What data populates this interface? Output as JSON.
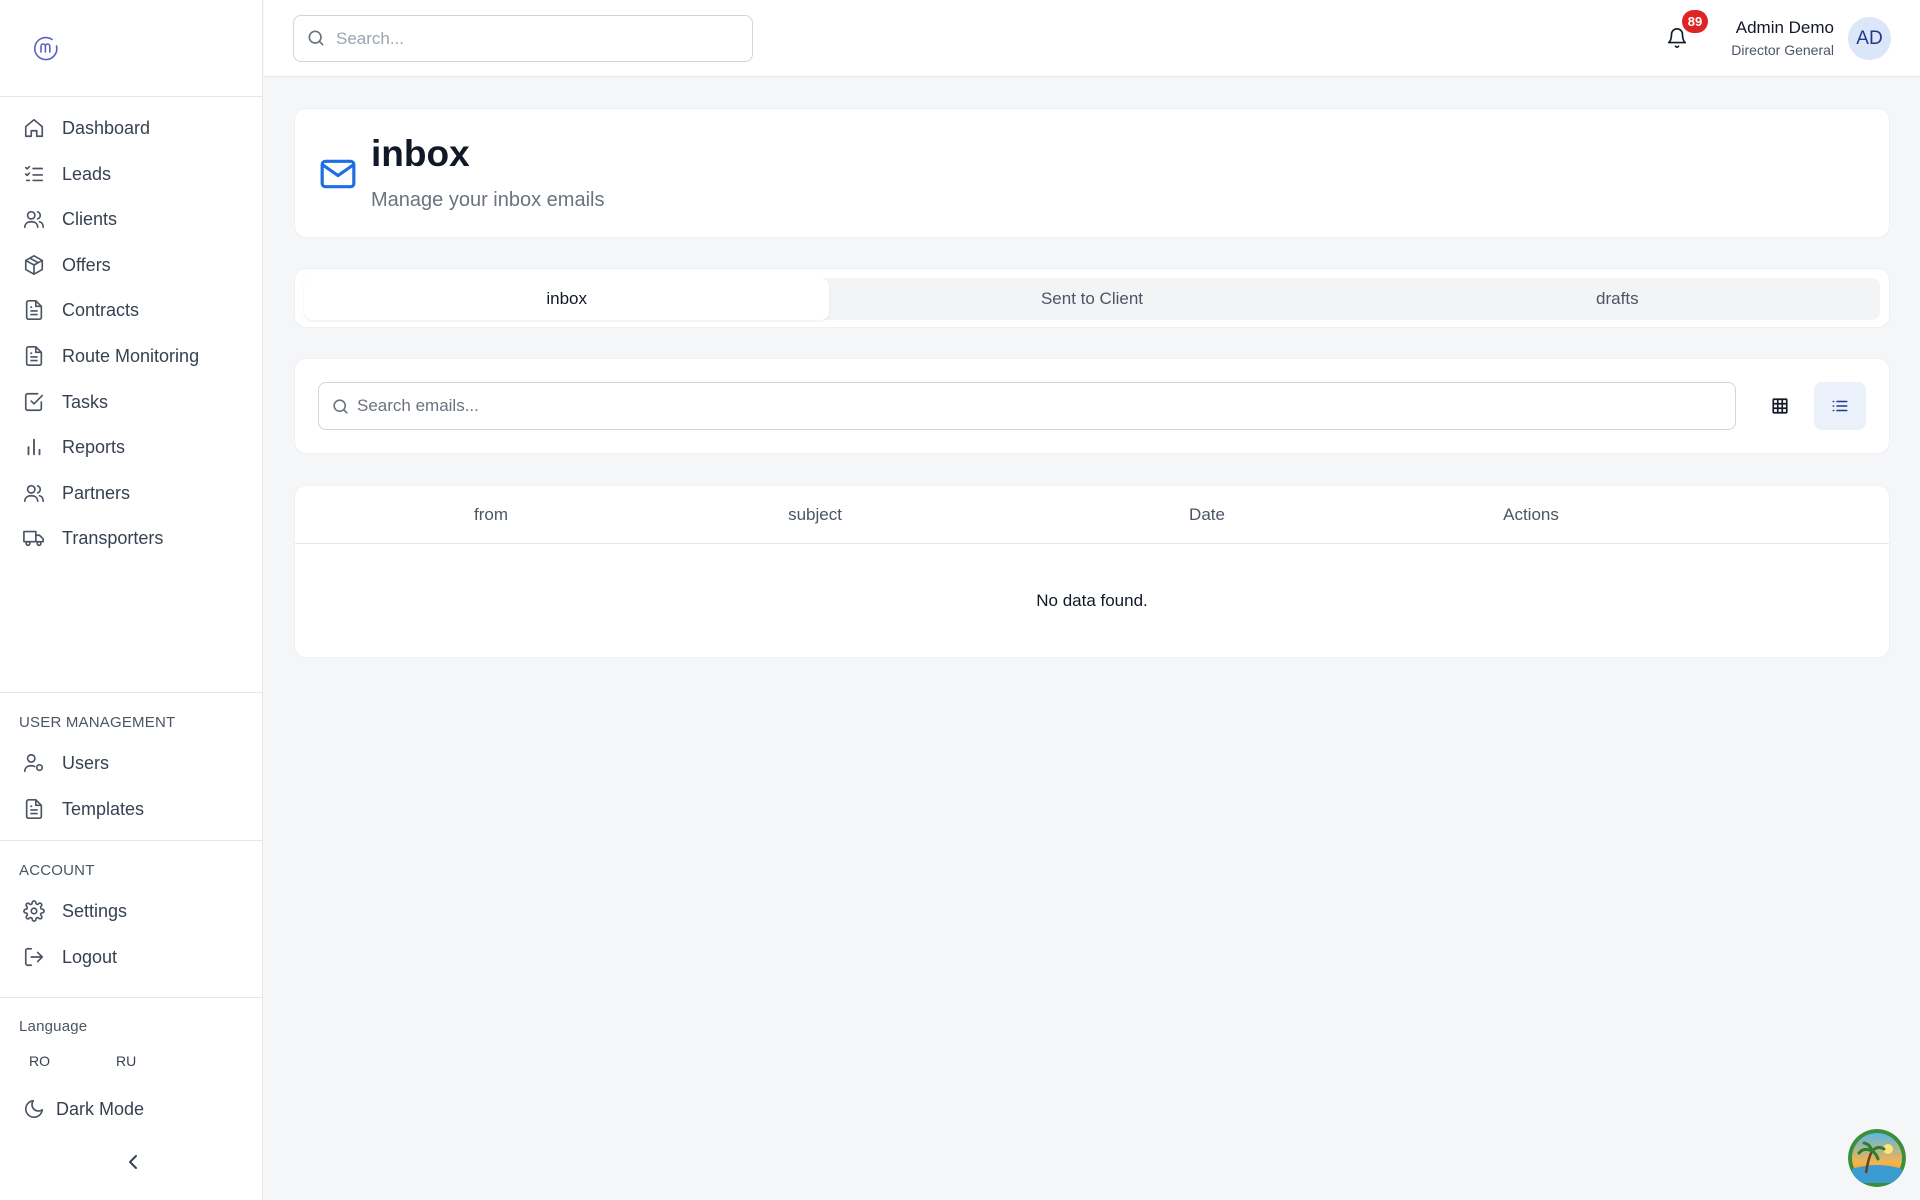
{
  "sidebar": {
    "nav": [
      {
        "label": "Dashboard",
        "icon": "home-icon"
      },
      {
        "label": "Leads",
        "icon": "list-check-icon"
      },
      {
        "label": "Clients",
        "icon": "users-icon"
      },
      {
        "label": "Offers",
        "icon": "package-icon"
      },
      {
        "label": "Contracts",
        "icon": "file-text-icon"
      },
      {
        "label": "Route Monitoring",
        "icon": "file-text-icon"
      },
      {
        "label": "Tasks",
        "icon": "check-square-icon"
      },
      {
        "label": "Reports",
        "icon": "bar-chart-icon"
      },
      {
        "label": "Partners",
        "icon": "users-icon"
      },
      {
        "label": "Transporters",
        "icon": "truck-icon"
      }
    ],
    "user_management": {
      "title": "USER MANAGEMENT",
      "items": [
        {
          "label": "Users",
          "icon": "user-cog-icon"
        },
        {
          "label": "Templates",
          "icon": "file-text-icon"
        }
      ]
    },
    "account": {
      "title": "ACCOUNT",
      "items": [
        {
          "label": "Settings",
          "icon": "gear-icon"
        },
        {
          "label": "Logout",
          "icon": "logout-icon"
        }
      ]
    },
    "language": {
      "title": "Language",
      "options": [
        "RO",
        "RU"
      ]
    },
    "dark_mode_label": "Dark Mode"
  },
  "header": {
    "search_placeholder": "Search...",
    "notification_count": "89",
    "user_name": "Admin Demo",
    "user_role": "Director General",
    "avatar_initials": "AD"
  },
  "page": {
    "title": "inbox",
    "subtitle": "Manage your inbox emails"
  },
  "tabs": [
    {
      "label": "inbox",
      "active": true
    },
    {
      "label": "Sent to Client",
      "active": false
    },
    {
      "label": "drafts",
      "active": false
    }
  ],
  "toolbar": {
    "search_placeholder": "Search emails...",
    "active_view": "list"
  },
  "table": {
    "columns": [
      "from",
      "subject",
      "Date",
      "Actions"
    ],
    "empty_text": "No data found."
  },
  "colors": {
    "accent": "#1d6ee0",
    "badge": "#dc2626"
  }
}
